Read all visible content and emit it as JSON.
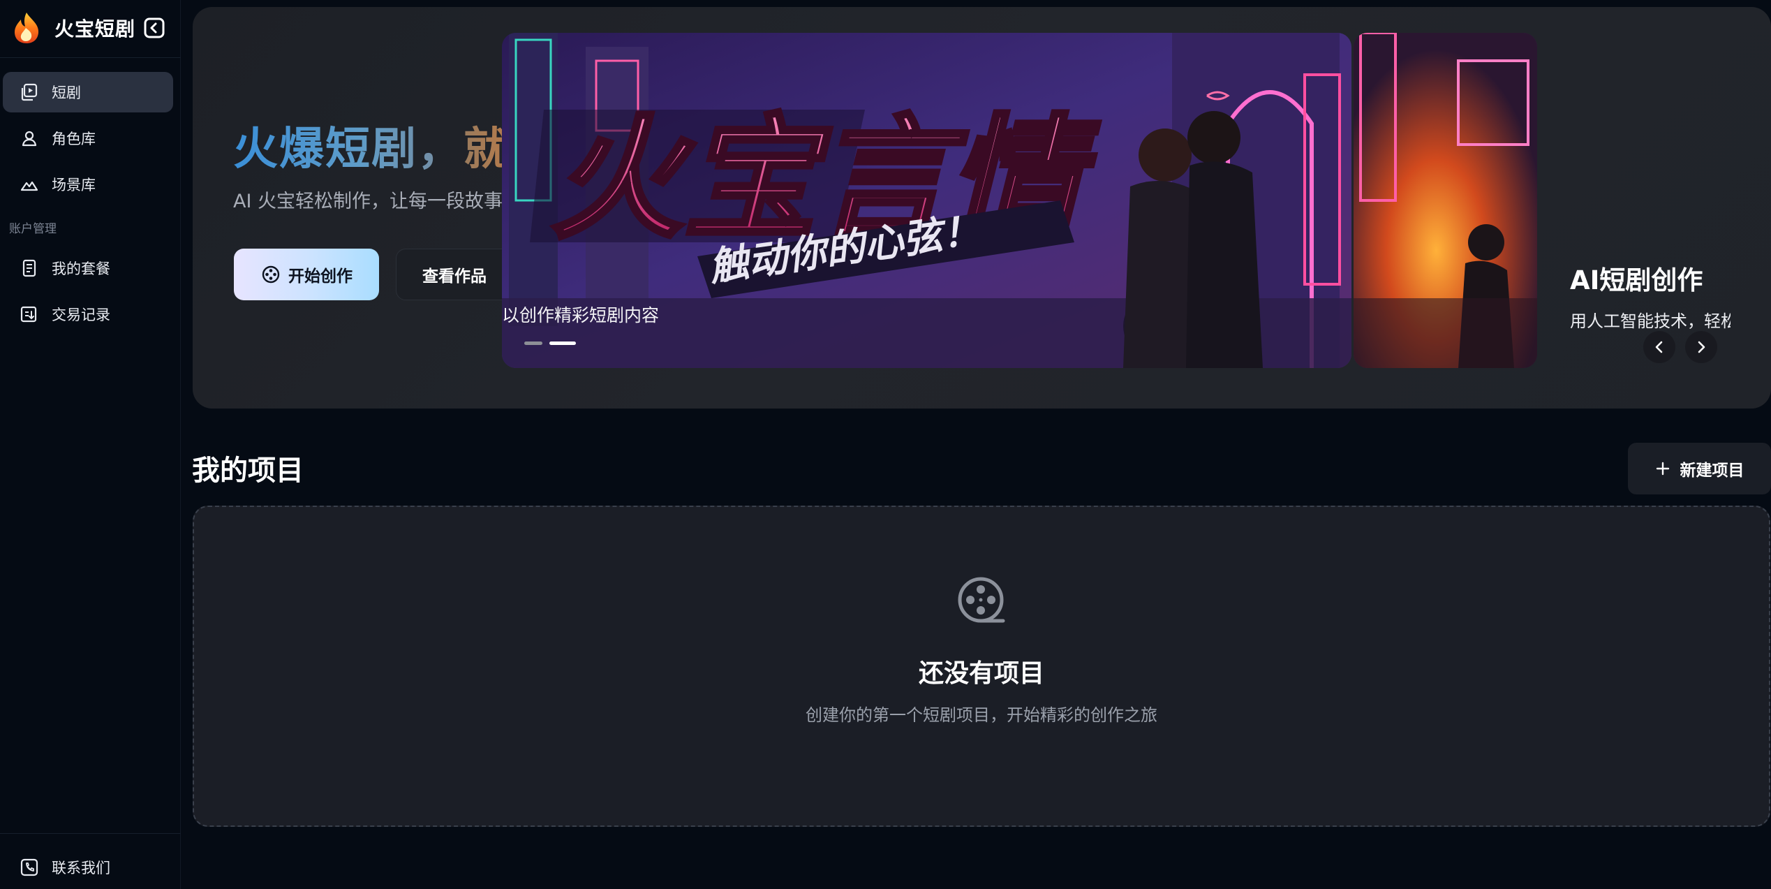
{
  "app": {
    "name": "火宝短剧"
  },
  "sidebar": {
    "items": [
      {
        "label": "短剧",
        "icon": "video-play-icon",
        "active": true
      },
      {
        "label": "角色库",
        "icon": "user-icon"
      },
      {
        "label": "场景库",
        "icon": "mountain-icon"
      }
    ],
    "section_label": "账户管理",
    "account_items": [
      {
        "label": "我的套餐",
        "icon": "receipt-icon"
      },
      {
        "label": "交易记录",
        "icon": "transaction-icon"
      }
    ],
    "footer_item": {
      "label": "联系我们",
      "icon": "phone-icon"
    }
  },
  "hero": {
    "title_part1": "火爆短剧，",
    "title_part2": "就用火宝",
    "subtitle": "AI 火宝轻松制作，让每一段故事都火起来",
    "start_label": "开始创作",
    "view_label": "查看作品",
    "carousel": {
      "current_banner_title": "火宝言情",
      "current_banner_slogan": "触动你的心弦！",
      "current_caption": "以创作精彩短剧内容",
      "next_title": "AI短剧创作",
      "next_desc": "用人工智能技术，轻松",
      "active_dot": 2,
      "dot_count": 2
    }
  },
  "projects": {
    "title": "我的项目",
    "new_label": "新建项目",
    "empty_title": "还没有项目",
    "empty_desc": "创建你的第一个短剧项目，开始精彩的创作之旅"
  },
  "colors": {
    "background": "#050b14",
    "sidebar_active": "#2a3140",
    "hero_card": "#202329",
    "title_blue": "#3a8fd8",
    "title_orange": "#ee7a23"
  }
}
